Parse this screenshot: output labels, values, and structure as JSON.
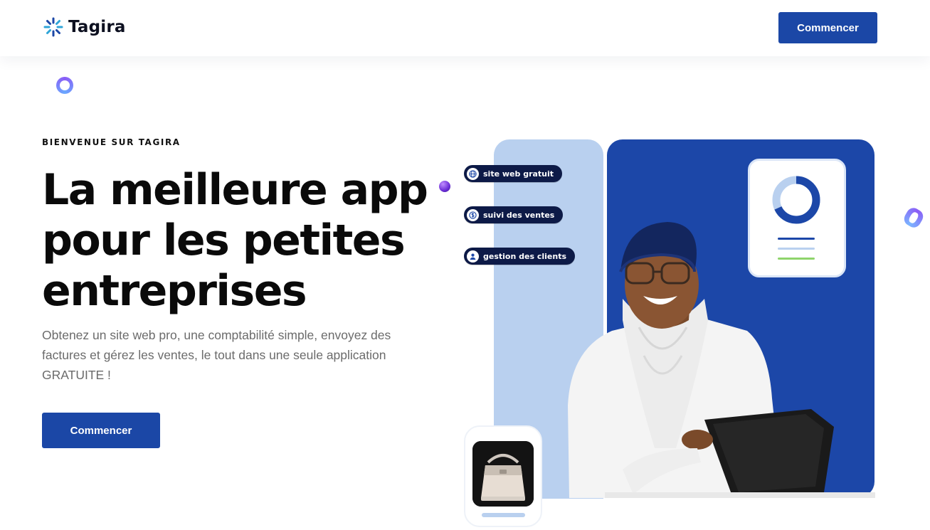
{
  "brand": {
    "name": "Tagira",
    "accent": "#1b47a6"
  },
  "nav": {
    "cta_label": "Commencer"
  },
  "hero": {
    "eyebrow": "BIENVENUE SUR TAGIRA",
    "title": "La meilleure app pour les petites entreprises",
    "description": "Obtenez un site web pro, une comptabilité simple, envoyez des factures et gérez les ventes, le tout dans une seule application GRATUITE !",
    "cta_label": "Commencer"
  },
  "illustration": {
    "chips": [
      {
        "label": "site web gratuit",
        "icon": "globe-icon"
      },
      {
        "label": "suivi des ventes",
        "icon": "dollar-icon"
      },
      {
        "label": "gestion des clients",
        "icon": "user-icon"
      }
    ],
    "colors": {
      "panel_blue": "#1c47a8",
      "panel_light": "#b9d0ef",
      "stat_green": "#8fd46b"
    }
  }
}
